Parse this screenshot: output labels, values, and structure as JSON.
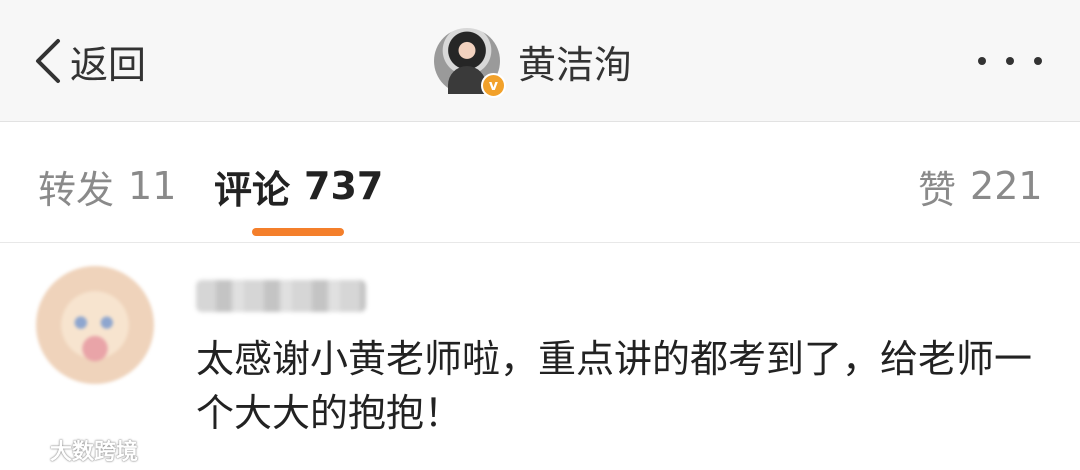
{
  "navbar": {
    "back_label": "返回",
    "profile_name": "黄洁洵",
    "verify_badge": "v"
  },
  "tabs": {
    "repost": {
      "label": "转发",
      "count": "11"
    },
    "comments": {
      "label": "评论",
      "count": "737"
    },
    "likes": {
      "label": "赞",
      "count": "221"
    },
    "active_color": "#f47f2b"
  },
  "comment": {
    "text": "太感谢小黄老师啦，重点讲的都考到了，给老师一个大大的抱抱！"
  },
  "watermark": {
    "text": "大数跨境"
  },
  "icons": {
    "back": "chevron-left-icon",
    "more": "more-dots-icon",
    "verify": "verified-badge-icon",
    "watermark": "weibo-logo-icon"
  }
}
